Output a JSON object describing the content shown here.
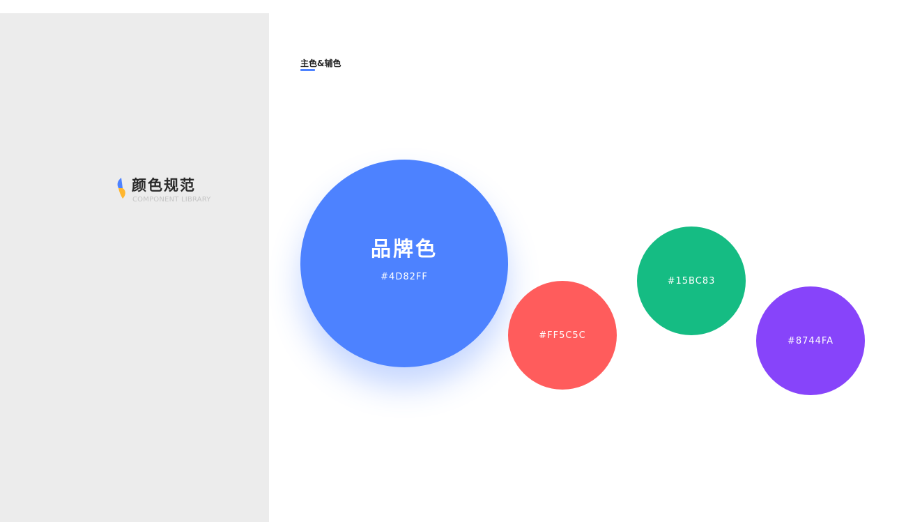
{
  "sidebar": {
    "title": "颜色规范",
    "subtitle": "COMPONENT LIBRARY",
    "logo_icon": "brand-logo-icon",
    "logo_colors": [
      "#4d82ff",
      "#ffb62e"
    ],
    "background": "#ececec"
  },
  "section": {
    "title": "主色&辅色",
    "underline_color": "#4d82ff"
  },
  "swatches": {
    "primary": {
      "name": "品牌色",
      "hex": "#4D82FF",
      "color": "#4d82ff"
    },
    "red": {
      "hex": "#FF5C5C",
      "color": "#ff5c5c"
    },
    "green": {
      "hex": "#15BC83",
      "color": "#15bc83"
    },
    "purple": {
      "hex": "#8744FA",
      "color": "#8744fa"
    }
  }
}
